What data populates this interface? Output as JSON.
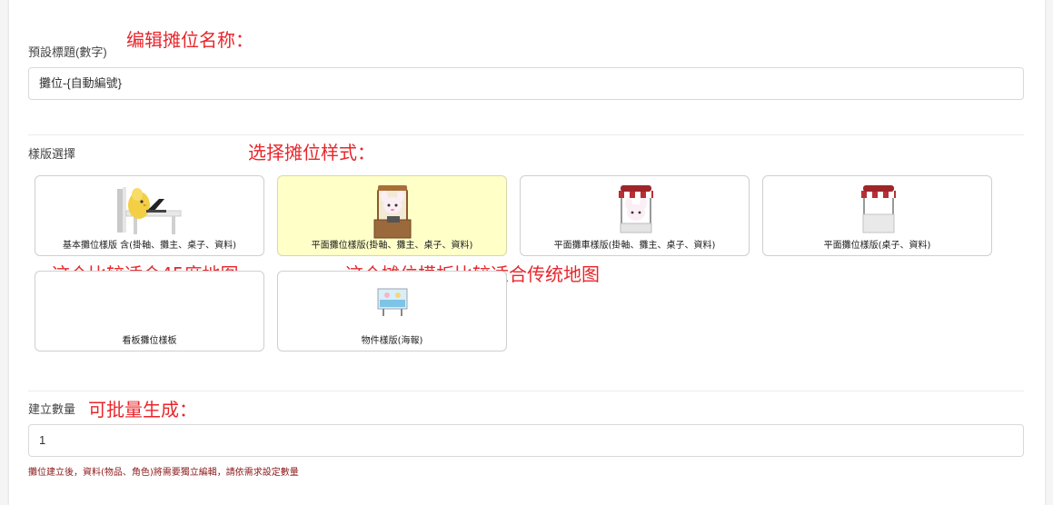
{
  "annotations": {
    "edit_name": "编辑摊位名称：",
    "choose_style": "选择摊位样式：",
    "map45": "这个比较适合45度地图",
    "traditional": "这个摊位模板比较适合传统地图",
    "batch": "可批量生成："
  },
  "title_field": {
    "label": "預設標題(數字)",
    "value": "攤位-{自動編號}"
  },
  "template_section": {
    "label": "樣版選擇",
    "cards": [
      {
        "title": "基本攤位樣版 含(掛軸、攤主、桌子、資料)",
        "icon": "chick-at-desk-icon",
        "selected": false
      },
      {
        "title": "平面攤位樣版(掛軸、攤主、桌子、資料)",
        "icon": "booth-with-bunny-icon",
        "selected": true
      },
      {
        "title": "平面攤車樣版(掛軸、攤主、桌子、資料)",
        "icon": "awning-cart-bunny-icon",
        "selected": false
      },
      {
        "title": "平面攤位樣版(桌子、資料)",
        "icon": "awning-stall-icon",
        "selected": false
      },
      {
        "title": "看板攤位樣板",
        "icon": "",
        "selected": false
      },
      {
        "title": "物件樣版(海報)",
        "icon": "poster-board-icon",
        "selected": false
      }
    ]
  },
  "quantity_field": {
    "label": "建立數量",
    "value": "1",
    "hint": "攤位建立後，資料(物品、角色)將需要獨立編輯，請依需求設定數量"
  },
  "colors": {
    "annotation": "#e8262b",
    "selected_card": "#ffffc8",
    "hint": "#8b1a1a"
  }
}
